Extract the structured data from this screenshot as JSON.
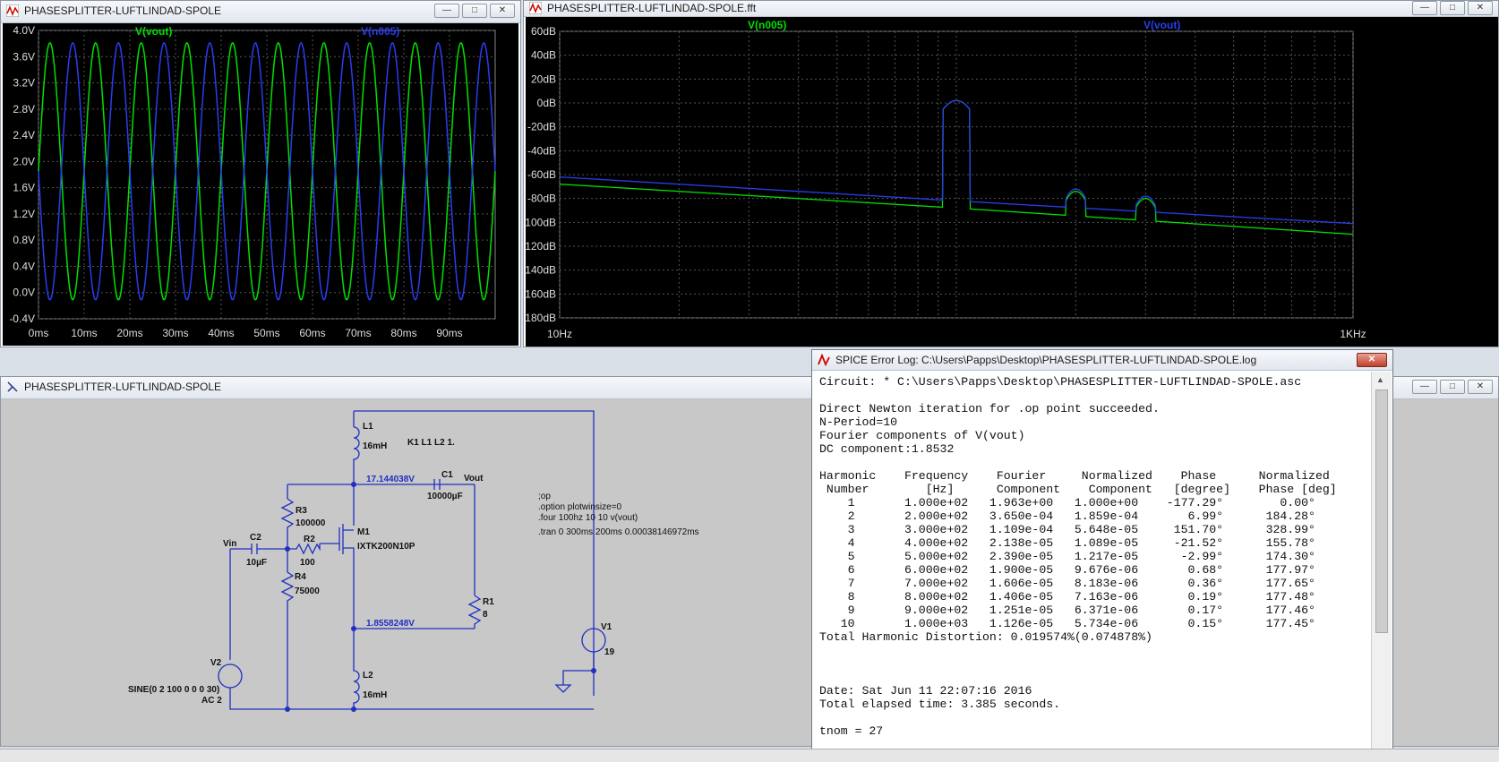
{
  "win_tran": {
    "title": "PHASESPLITTER-LUFTLINDAD-SPOLE",
    "trace1": "V(vout)",
    "trace2": "V(n005)"
  },
  "win_fft": {
    "title": "PHASESPLITTER-LUFTLINDAD-SPOLE.fft",
    "trace1": "V(n005)",
    "trace2": "V(vout)"
  },
  "win_schematic": {
    "title": "PHASESPLITTER-LUFTLINDAD-SPOLE"
  },
  "win_log": {
    "title": "SPICE Error Log: C:\\Users\\Papps\\Desktop\\PHASESPLITTER-LUFTLINDAD-SPOLE.log"
  },
  "chart_data": [
    {
      "type": "line",
      "xlabel": "",
      "ylabel": "",
      "x_ticks": [
        "0ms",
        "10ms",
        "20ms",
        "30ms",
        "40ms",
        "50ms",
        "60ms",
        "70ms",
        "80ms",
        "90ms"
      ],
      "y_ticks": [
        "4.0V",
        "3.6V",
        "3.2V",
        "2.8V",
        "2.4V",
        "2.0V",
        "1.6V",
        "1.2V",
        "0.8V",
        "0.4V",
        "0.0V",
        "-0.4V"
      ],
      "xlim_ms": [
        0,
        100
      ],
      "ylim_V": [
        -0.4,
        4.0
      ],
      "grid": true,
      "series": [
        {
          "name": "V(vout)",
          "color": "#00e000",
          "waveform": "sine",
          "freq_hz": 100,
          "dc_V": 1.85,
          "amp_V": 1.96,
          "phase_deg": 0
        },
        {
          "name": "V(n005)",
          "color": "#2a3df0",
          "waveform": "sine",
          "freq_hz": 100,
          "dc_V": 1.85,
          "amp_V": 1.96,
          "phase_deg": 180
        }
      ]
    },
    {
      "type": "line",
      "xlabel": "",
      "ylabel": "",
      "x_ticks": [
        "10Hz",
        "1KHz"
      ],
      "x_scale": "log",
      "xlim_hz": [
        10,
        1000
      ],
      "y_ticks": [
        "60dB",
        "40dB",
        "20dB",
        "0dB",
        "-20dB",
        "-40dB",
        "-60dB",
        "-80dB",
        "-100dB",
        "-120dB",
        "-140dB",
        "-160dB",
        "-180dB"
      ],
      "ylim_dB": [
        -180,
        60
      ],
      "grid": true,
      "series": [
        {
          "name": "V(n005)",
          "color": "#00e000",
          "baseline_db": [
            [
              10,
              -68
            ],
            [
              100,
              -88
            ],
            [
              1000,
              -110
            ]
          ],
          "peaks": [
            {
              "hz": 100,
              "db": 2
            },
            {
              "hz": 200,
              "db": -74
            },
            {
              "hz": 300,
              "db": -80
            }
          ]
        },
        {
          "name": "V(vout)",
          "color": "#2a3df0",
          "baseline_db": [
            [
              10,
              -62
            ],
            [
              100,
              -82
            ],
            [
              1000,
              -101
            ]
          ],
          "peaks": [
            {
              "hz": 100,
              "db": 2
            },
            {
              "hz": 200,
              "db": -72
            },
            {
              "hz": 300,
              "db": -78
            }
          ]
        }
      ]
    }
  ],
  "schematic": {
    "labels": {
      "L1": "L1",
      "L1_val": "16mH",
      "k": "K1 L1 L2 1.",
      "node_top": "17.144038V",
      "C1": "C1",
      "C1_val": "10000µF",
      "vout": "Vout",
      "R3": "R3",
      "R3_val": "100000",
      "M1": "M1",
      "M1_val": "IXTK200N10P",
      "vin": "Vin",
      "C2": "C2",
      "C2_val": "10µF",
      "R2": "R2",
      "R2_val": "100",
      "R4": "R4",
      "R4_val": "75000",
      "R1": "R1",
      "R1_val": "8",
      "node_bot": "1.8558248V",
      "V1": "V1",
      "V1_val": "19",
      "V2": "V2",
      "V2_val1": "SINE(0 2 100 0 0 0 30)",
      "V2_val2": "AC 2",
      "L2": "L2",
      "L2_val": "16mH",
      "dir1": ";op",
      "dir2": ".option plotwinsize=0",
      "dir3": ".four 100hz 10 10 v(vout)",
      "dir4": ".tran 0 300ms 200ms 0.00038146972ms"
    }
  },
  "log": {
    "lines": [
      "Circuit: * C:\\Users\\Papps\\Desktop\\PHASESPLITTER-LUFTLINDAD-SPOLE.asc",
      "",
      "Direct Newton iteration for .op point succeeded.",
      "N-Period=10",
      "Fourier components of V(vout)",
      "DC component:1.8532",
      "",
      "Harmonic    Frequency    Fourier     Normalized    Phase      Normalized",
      " Number        [Hz]      Component    Component   [degree]    Phase [deg]",
      "    1       1.000e+02   1.963e+00   1.000e+00    -177.29°        0.00°",
      "    2       2.000e+02   3.650e-04   1.859e-04       6.99°      184.28°",
      "    3       3.000e+02   1.109e-04   5.648e-05     151.70°      328.99°",
      "    4       4.000e+02   2.138e-05   1.089e-05     -21.52°      155.78°",
      "    5       5.000e+02   2.390e-05   1.217e-05      -2.99°      174.30°",
      "    6       6.000e+02   1.900e-05   9.676e-06       0.68°      177.97°",
      "    7       7.000e+02   1.606e-05   8.183e-06       0.36°      177.65°",
      "    8       8.000e+02   1.406e-05   7.163e-06       0.19°      177.48°",
      "    9       9.000e+02   1.251e-05   6.371e-06       0.17°      177.46°",
      "   10       1.000e+03   1.126e-05   5.734e-06       0.15°      177.45°",
      "Total Harmonic Distortion: 0.019574%(0.074878%)",
      "",
      "",
      "",
      "Date: Sat Jun 11 22:07:16 2016",
      "Total elapsed time: 3.385 seconds.",
      "",
      "tnom = 27"
    ]
  }
}
